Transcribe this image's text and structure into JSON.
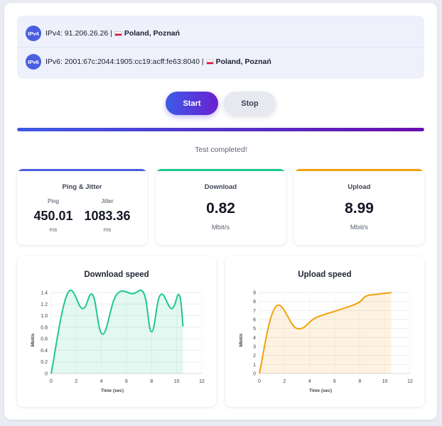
{
  "ipv4": {
    "badge": "IPv4",
    "text": "IPv4: 91.206.26.26 |",
    "location": "Poland, Poznań"
  },
  "ipv6": {
    "badge": "IPv6",
    "text": "IPv6: 2001:67c:2044:1905:cc19:acff:fe63:8040 |",
    "location": "Poland, Poznań"
  },
  "controls": {
    "start_label": "Start",
    "stop_label": "Stop",
    "progress": 1.0
  },
  "status_text": "Test completed!",
  "ping_jitter": {
    "title": "Ping & Jitter",
    "ping_label": "Ping",
    "ping_value": "450.01",
    "ping_unit": "ms",
    "jitter_label": "Jitter",
    "jitter_value": "1083.36",
    "jitter_unit": "ms"
  },
  "download": {
    "title": "Download",
    "value": "0.82",
    "unit": "Mbit/s"
  },
  "upload": {
    "title": "Upload",
    "value": "8.99",
    "unit": "Mbit/s"
  },
  "colors": {
    "ping_accent": "#4a5fe0",
    "download_accent": "#1ec98a",
    "upload_accent": "#f2a20f"
  },
  "chart_data": [
    {
      "type": "area",
      "title": "Download speed",
      "xlabel": "Time (sec)",
      "ylabel": "Mbit/s",
      "xlim": [
        0,
        12
      ],
      "ylim": [
        0,
        1.4
      ],
      "xticks": [
        0,
        2,
        4,
        6,
        8,
        10,
        12
      ],
      "yticks": [
        0,
        0.2,
        0.4,
        0.6,
        0.8,
        1.0,
        1.2,
        1.4
      ],
      "ytick_labels": [
        "0",
        "0.2",
        "0.4",
        "0.6",
        "0.8",
        "1.0",
        "1.2",
        "1.4"
      ],
      "color": "#1ec98a",
      "x": [
        0,
        1.3,
        2.5,
        3.3,
        4.1,
        5.2,
        6.5,
        7.4,
        8.0,
        8.7,
        9.6,
        10.2,
        10.5
      ],
      "y": [
        0,
        1.38,
        1.12,
        1.36,
        0.68,
        1.36,
        1.38,
        1.38,
        0.72,
        1.36,
        1.12,
        1.36,
        0.82
      ]
    },
    {
      "type": "area",
      "title": "Upload speed",
      "xlabel": "Time (sec)",
      "ylabel": "Mbit/s",
      "xlim": [
        0,
        12
      ],
      "ylim": [
        0,
        9
      ],
      "xticks": [
        0,
        2,
        4,
        6,
        8,
        10,
        12
      ],
      "yticks": [
        0,
        1,
        2,
        3,
        4,
        5,
        6,
        7,
        8,
        9
      ],
      "ytick_labels": [
        "0",
        "1",
        "2",
        "3",
        "4",
        "5",
        "6",
        "7",
        "8",
        "9"
      ],
      "color": "#f2a20f",
      "x": [
        0,
        1.3,
        3.0,
        4.5,
        6.2,
        7.8,
        8.5,
        9.3,
        10.5
      ],
      "y": [
        0,
        7.4,
        5.0,
        6.2,
        7.0,
        7.8,
        8.6,
        8.8,
        8.99
      ]
    }
  ]
}
